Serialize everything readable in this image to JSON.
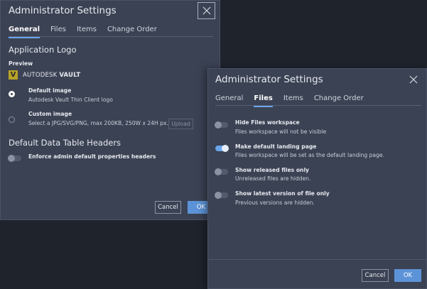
{
  "dialog1": {
    "title": "Administrator Settings",
    "tabs": [
      "General",
      "Files",
      "Items",
      "Change Order"
    ],
    "app_logo_heading": "Application Logo",
    "preview_label": "Preview",
    "logo_letter": "V",
    "logo_text_prefix": "AUTODESK",
    "logo_text_product": "VAULT",
    "default_image_label": "Default image",
    "default_image_desc": "Autodesk Vault Thin Client logo",
    "custom_image_label": "Custom image",
    "custom_image_desc": "Select a JPG/SVG/PNG, max 200KB, 250W x 24H px.",
    "upload_label": "Upload",
    "table_headers_heading": "Default Data Table Headers",
    "enforce_label": "Enforce admin default properties headers",
    "cancel_label": "Cancel",
    "ok_label": "OK"
  },
  "dialog2": {
    "title": "Administrator Settings",
    "tabs": [
      "General",
      "Files",
      "Items",
      "Change Order"
    ],
    "settings": [
      {
        "label": "Hide Files workspace",
        "desc": "Files workspace will not be visible",
        "on": false
      },
      {
        "label": "Make default landing page",
        "desc": "Files workspace will be set as the default landing page.",
        "on": true
      },
      {
        "label": "Show released files only",
        "desc": "Unreleased files are hidden.",
        "on": false
      },
      {
        "label": "Show latest version of file only",
        "desc": "Previous versions are hidden.",
        "on": false
      }
    ],
    "cancel_label": "Cancel",
    "ok_label": "OK"
  },
  "colors": {
    "accent": "#6aa5ea",
    "primary_button": "#5c93d8",
    "dialog_bg": "#3b4253",
    "page_bg": "#1f232c",
    "logo_yellow": "#b8a226"
  }
}
